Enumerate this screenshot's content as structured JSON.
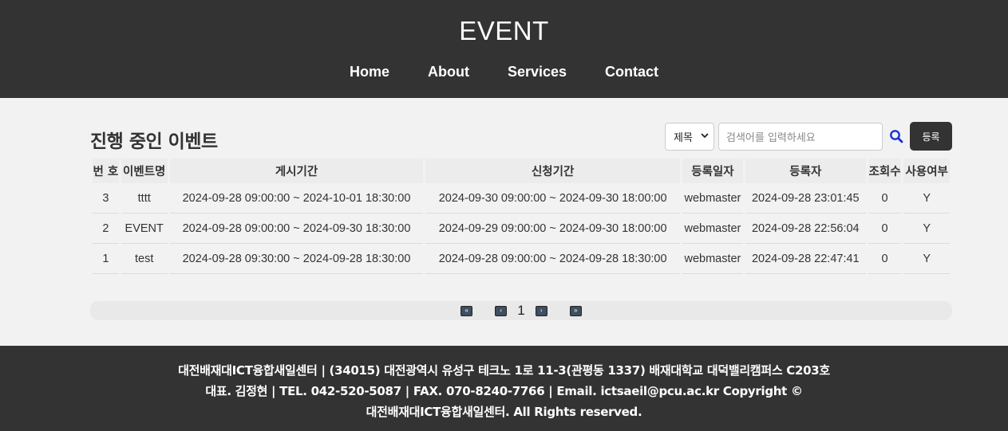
{
  "header": {
    "title": "EVENT",
    "nav": [
      "Home",
      "About",
      "Services",
      "Contact"
    ]
  },
  "main": {
    "heading": "진행 중인 이벤트",
    "search": {
      "field_selected": "제목",
      "placeholder": "검색어를 입력하세요",
      "register_label": "등록"
    },
    "table": {
      "columns": [
        "번 호",
        "이벤트명",
        "게시기간",
        "신청기간",
        "등록일자",
        "등록자",
        "조회수",
        "사용여부"
      ],
      "rows": [
        [
          "3",
          "tttt",
          "2024-09-28 09:00:00 ~ 2024-10-01 18:30:00",
          "2024-09-30 09:00:00 ~ 2024-09-30 18:00:00",
          "webmaster",
          "2024-09-28 23:01:45",
          "0",
          "Y"
        ],
        [
          "2",
          "EVENT",
          "2024-09-28 09:00:00 ~ 2024-09-30 18:30:00",
          "2024-09-29 09:00:00 ~ 2024-09-30 18:00:00",
          "webmaster",
          "2024-09-28 22:56:04",
          "0",
          "Y"
        ],
        [
          "1",
          "test",
          "2024-09-28 09:30:00 ~ 2024-09-28 18:30:00",
          "2024-09-28 09:00:00 ~ 2024-09-28 18:30:00",
          "webmaster",
          "2024-09-28 22:47:41",
          "0",
          "Y"
        ]
      ]
    },
    "pagination": {
      "first": "«",
      "prev": "‹",
      "current": "1",
      "next": "›",
      "last": "»"
    }
  },
  "footer": {
    "line1": "대전배재대ICT융합새일센터 | (34015) 대전광역시 유성구 테크노 1로 11-3(관평동 1337) 배재대학교 대덕밸리캠퍼스 C203호",
    "line2": "대표. 김정현 | TEL. 042-520-5087 | FAX. 070-8240-7766 | Email. ictsaeil@pcu.ac.kr Copyright ©",
    "line3": "대전배재대ICT융합새일센터. All Rights reserved."
  },
  "colors": {
    "header_bg": "#333333",
    "footer_bg": "#333333",
    "body_bg": "#f2f2f2",
    "search_icon": "#1a2fd6"
  }
}
